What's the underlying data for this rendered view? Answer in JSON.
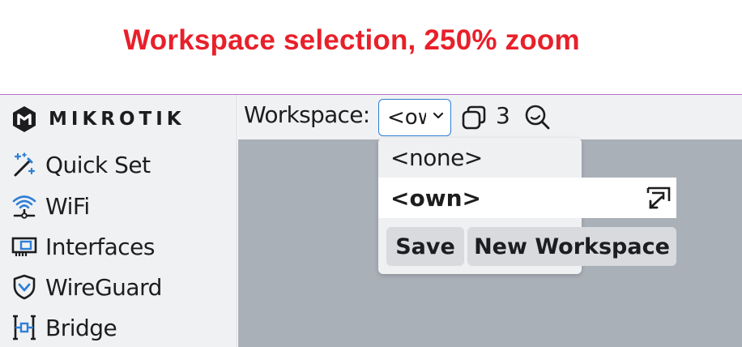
{
  "caption": "Workspace selection, 250% zoom",
  "brand": {
    "name": "MIKROTIK",
    "icon": "mikrotik-logo-icon"
  },
  "sidebar": {
    "items": [
      {
        "label": "Quick Set",
        "icon": "magic-wand-icon"
      },
      {
        "label": "WiFi",
        "icon": "wifi-icon"
      },
      {
        "label": "Interfaces",
        "icon": "network-card-icon"
      },
      {
        "label": "WireGuard",
        "icon": "shield-icon"
      },
      {
        "label": "Bridge",
        "icon": "bridge-icon"
      }
    ]
  },
  "toolbar": {
    "workspace_label": "Workspace:",
    "workspace_value": "<own>",
    "windows_count": "3",
    "icons": [
      "windows-stack-icon",
      "search-zoom-icon"
    ]
  },
  "workspace_menu": {
    "options": [
      "<none>",
      "<own>"
    ],
    "selected": "<own>",
    "selected_icon": "share-icon",
    "save_label": "Save",
    "new_label": "New Workspace"
  },
  "colors": {
    "caption": "#e8202a",
    "accent": "#2e7fd6",
    "sidebar_bg": "#f0f1f3",
    "workarea_bg": "#aab0b8"
  }
}
